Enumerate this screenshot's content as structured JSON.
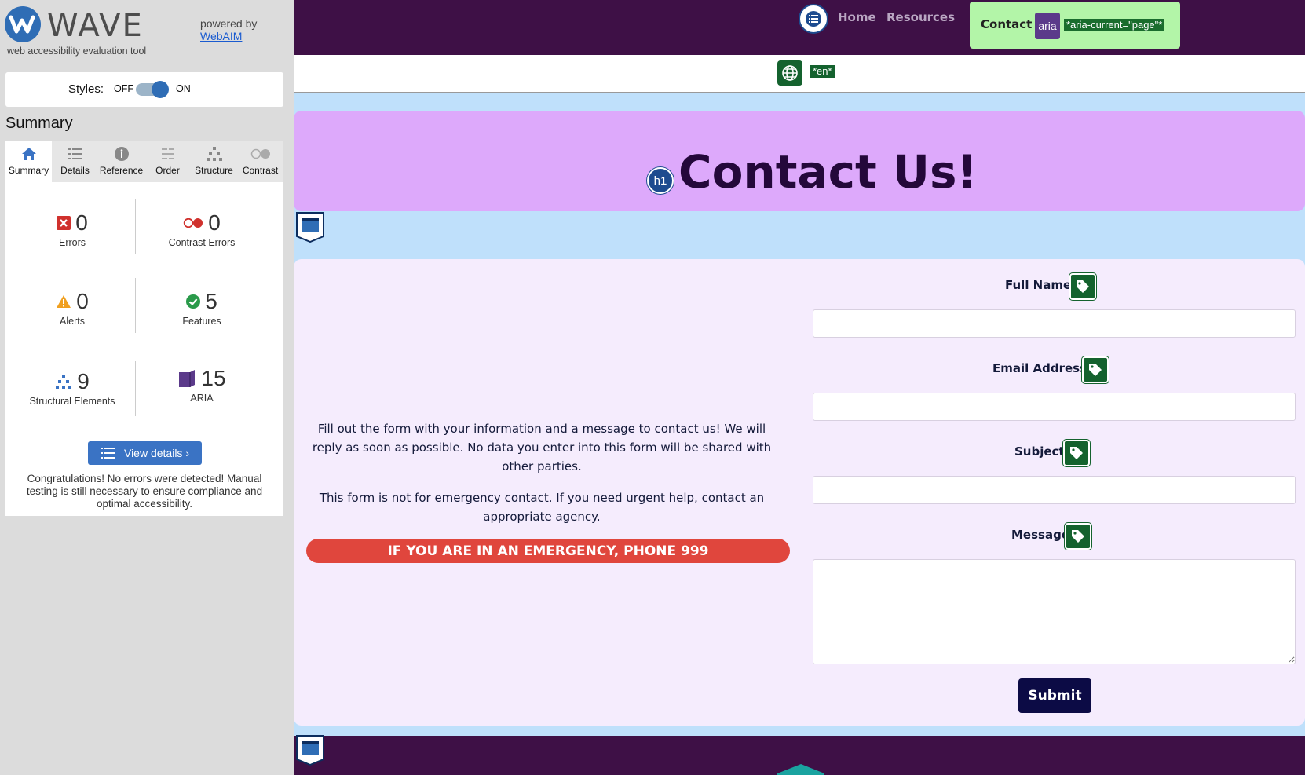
{
  "wave": {
    "brand": "WAVE",
    "tagline": "web accessibility evaluation tool",
    "powered_by": "powered by",
    "powered_link": "WebAIM",
    "styles_label": "Styles:",
    "toggle_off": "OFF",
    "toggle_on": "ON",
    "summary_heading": "Summary",
    "tabs": [
      {
        "label": "Summary",
        "icon": "home-icon"
      },
      {
        "label": "Details",
        "icon": "list-icon"
      },
      {
        "label": "Reference",
        "icon": "info-icon"
      },
      {
        "label": "Order",
        "icon": "order-icon"
      },
      {
        "label": "Structure",
        "icon": "structure-icon"
      },
      {
        "label": "Contrast",
        "icon": "contrast-icon"
      }
    ],
    "stats": {
      "errors": {
        "count": "0",
        "label": "Errors"
      },
      "contrast_errors": {
        "count": "0",
        "label": "Contrast Errors"
      },
      "alerts": {
        "count": "0",
        "label": "Alerts"
      },
      "features": {
        "count": "5",
        "label": "Features"
      },
      "structural": {
        "count": "9",
        "label": "Structural Elements"
      },
      "aria": {
        "count": "15",
        "label": "ARIA"
      }
    },
    "view_details": "View details ›",
    "congrats": "Congratulations! No errors were detected! Manual testing is still necessary to ensure compliance and optimal accessibility."
  },
  "site": {
    "nav": {
      "home": "Home",
      "resources": "Resources",
      "contact": "Contact",
      "aria_badge": "aria",
      "aria_attr": "*aria-current=\"page\"*"
    },
    "lang_tag": "*en*",
    "h1_badge": "h1",
    "title": "Contact Us!",
    "info_1": "Fill out the form with your information and a message to contact us! We will reply as soon as possible. No data you enter into this form will be shared with other parties.",
    "info_2": "This form is not for emergency contact. If you need urgent help, contact an appropriate agency.",
    "emergency": "IF YOU ARE IN AN EMERGENCY, PHONE 999",
    "form": {
      "full_name": "Full Name",
      "email": "Email Address",
      "subject": "Subject",
      "message": "Message",
      "submit": "Submit"
    }
  },
  "colors": {
    "nav_bg": "#3e1046",
    "hero_bg": "#dda9fb",
    "page_bg": "#bfe0fb",
    "card_bg": "#f5ecfd",
    "emergency": "#e0463d",
    "submit": "#0c0b45",
    "active_nav": "#b3f5a8",
    "wave_blue": "#2f6db5"
  }
}
